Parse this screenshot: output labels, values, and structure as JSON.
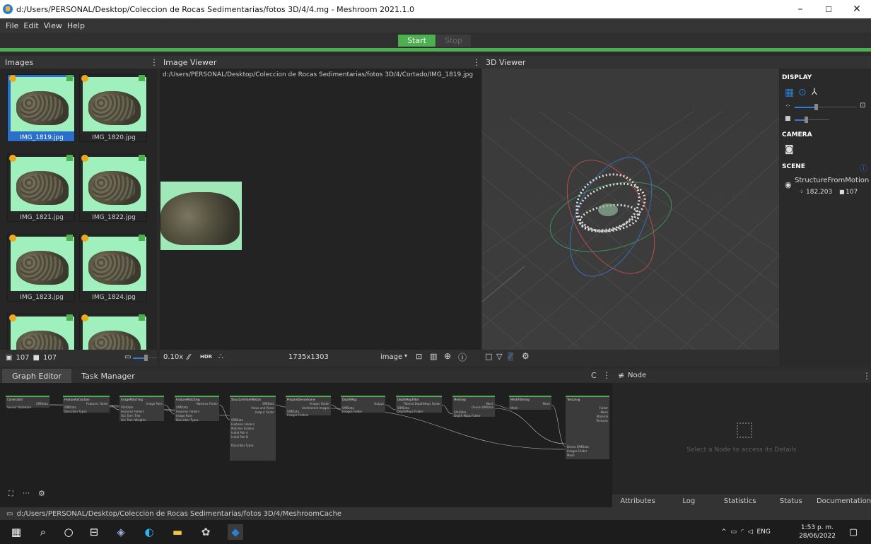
{
  "window": {
    "title": "d:/Users/PERSONAL/Desktop/Coleccion de Rocas Sedimentarias/fotos 3D/4/4.mg - Meshroom 2021.1.0",
    "controls": [
      "–",
      "☐",
      "✕"
    ]
  },
  "menu": [
    "File",
    "Edit",
    "View",
    "Help"
  ],
  "toolbar": {
    "start_label": "Start",
    "stop_label": "Stop"
  },
  "images_panel": {
    "title": "Images",
    "thumbnails": [
      "IMG_1819.jpg",
      "IMG_1820.jpg",
      "IMG_1821.jpg",
      "IMG_1822.jpg",
      "IMG_1823.jpg",
      "IMG_1824.jpg",
      "",
      ""
    ],
    "selected": "IMG_1819.jpg",
    "footer_images_count": "107",
    "footer_cameras_count": "107"
  },
  "image_viewer": {
    "title": "Image Viewer",
    "path": "d:/Users/PERSONAL/Desktop/Coleccion de Rocas Sedimentarias/fotos 3D/4/Cortado/IMG_1819.jpg",
    "zoom": "0.10x",
    "hdr_label": "HDR",
    "resolution": "1735x1303",
    "mode": "image"
  },
  "viewer_3d": {
    "title": "3D Viewer"
  },
  "side_panel": {
    "display_label": "DISPLAY",
    "camera_label": "CAMERA",
    "scene_label": "SCENE",
    "scene_item": "StructureFromMotion",
    "points_count": "182,203",
    "cameras_count": "107"
  },
  "graph_editor": {
    "tabs": [
      "Graph Editor",
      "Task Manager"
    ],
    "nodes": [
      {
        "title": "CameraInit",
        "outputs": [
          "SfMData"
        ],
        "inputs": [
          "Sensor Database"
        ]
      },
      {
        "title": "FeatureExtraction",
        "outputs": [
          "Features Folder"
        ],
        "inputs": [
          "SfMData",
          "Describer Types"
        ]
      },
      {
        "title": "ImageMatching",
        "outputs": [
          "Image Pairs"
        ],
        "inputs": [
          "SfmData",
          "Features Folders",
          "Voc Tree: Tree",
          "Voc Tree: Weights"
        ]
      },
      {
        "title": "FeatureMatching",
        "outputs": [
          "Matches Folder"
        ],
        "inputs": [
          "SfMData",
          "Features Folders",
          "Image Pairs",
          "Describer Types"
        ]
      },
      {
        "title": "StructureFromMotion",
        "outputs": [
          "SfMData",
          "Views and Poses",
          "Output Folder"
        ],
        "inputs": [
          "SfMData",
          "Features Folders",
          "Matches Folders",
          "Initial Pair A",
          "Initial Pair B",
          "Describer Types"
        ]
      },
      {
        "title": "PrepareDenseScene",
        "outputs": [
          "Images Folder",
          "Undistorted Images"
        ],
        "inputs": [
          "SfMData",
          "Images Folders"
        ]
      },
      {
        "title": "DepthMap",
        "outputs": [
          "Output"
        ],
        "inputs": [
          "SfMData",
          "Images Folder"
        ]
      },
      {
        "title": "DepthMapFilter",
        "outputs": [
          "Filtered DepthMaps Folder"
        ],
        "inputs": [
          "SfMData",
          "DepthMaps Folder"
        ]
      },
      {
        "title": "Meshing",
        "outputs": [
          "Mesh",
          "Dense SfMData"
        ],
        "inputs": [
          "SfmData",
          "Depth Maps Folder"
        ]
      },
      {
        "title": "MeshFiltering",
        "outputs": [
          "Mesh"
        ],
        "inputs": [
          "Mesh"
        ]
      },
      {
        "title": "Texturing",
        "outputs": [
          "Folder",
          "Mesh",
          "Material",
          "Textures"
        ],
        "inputs": [
          "Dense SfMData",
          "Images Folder",
          "Mesh"
        ]
      }
    ]
  },
  "node_panel": {
    "title": "Node",
    "placeholder": "Select a Node to access its Details",
    "tabs": [
      "Attributes",
      "Log",
      "Statistics",
      "Status",
      "Documentation"
    ]
  },
  "status_bar": {
    "path": "d:/Users/PERSONAL/Desktop/Coleccion de Rocas Sedimentarias/fotos 3D/4/MeshroomCache"
  },
  "taskbar": {
    "language": "ENG",
    "time": "1:53 p. m.",
    "date": "28/06/2022"
  },
  "colors": {
    "accent_green": "#4caf50",
    "selection_blue": "#2a6fc9",
    "thumb_background": "#9ff0bd"
  }
}
